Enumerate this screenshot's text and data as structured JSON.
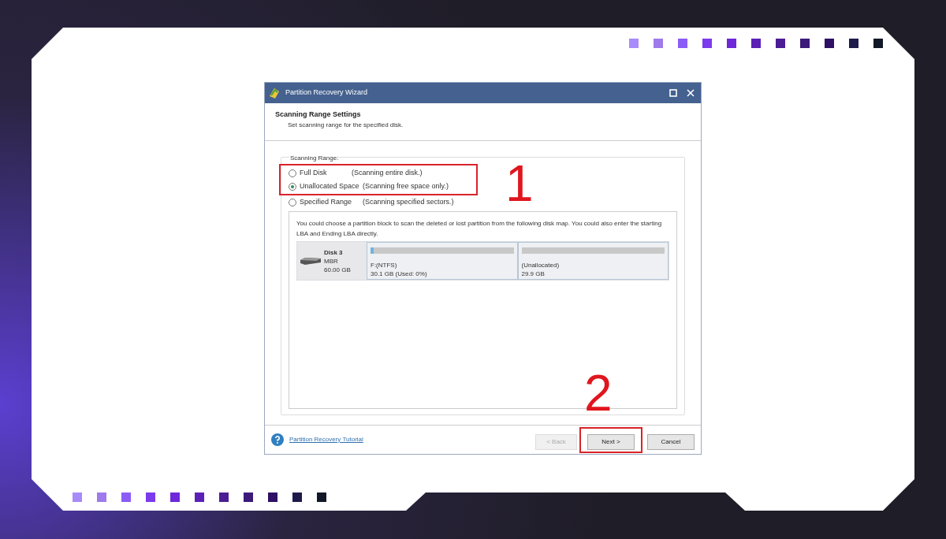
{
  "window": {
    "title": "Partition Recovery Wizard"
  },
  "header": {
    "title": "Scanning Range Settings",
    "subtitle": "Set scanning range for the specified disk."
  },
  "scanning_range": {
    "label": "Scanning Range:",
    "options": [
      {
        "label": "Full Disk",
        "description": "(Scanning entire disk.)",
        "selected": false,
        "highlighted": true
      },
      {
        "label": "Unallocated Space",
        "description": "(Scanning free space only.)",
        "selected": true,
        "highlighted": true
      },
      {
        "label": "Specified Range",
        "description": "(Scanning specified sectors.)",
        "selected": false,
        "highlighted": false
      }
    ]
  },
  "instructions": "You could choose a partition block to scan the deleted or lost partition from the following disk map. You could also enter the starting LBA and Ending LBA directly.",
  "disk": {
    "name": "Disk 3",
    "type": "MBR",
    "size": "60.00 GB",
    "partitions": [
      {
        "label": "F:(NTFS)",
        "detail": "30.1 GB (Used: 0%)",
        "level": 0.02
      },
      {
        "label": "(Unallocated)",
        "detail": "29.9 GB",
        "level": 0
      }
    ]
  },
  "footer": {
    "link": "Partition Recovery Tutorial",
    "buttons": [
      {
        "label": "< Back",
        "disabled": true,
        "highlighted": false
      },
      {
        "label": "Next >",
        "disabled": false,
        "highlighted": true
      },
      {
        "label": "Cancel",
        "disabled": false,
        "highlighted": false
      }
    ]
  },
  "annotations": [
    {
      "text": "1"
    },
    {
      "text": "2"
    }
  ]
}
